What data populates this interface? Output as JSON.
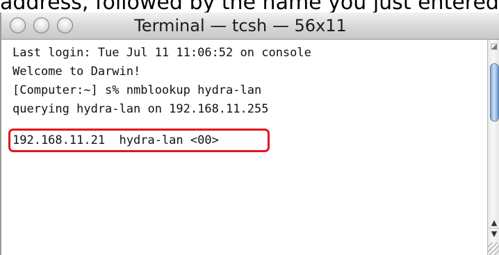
{
  "caption": "address, followed by the name you just entered.",
  "window": {
    "title": "Terminal — tcsh — 56x11"
  },
  "terminal": {
    "lines": [
      "Last login: Tue Jul 11 11:06:52 on console",
      "Welcome to Darwin!",
      "[Computer:~] s% nmblookup hydra-lan",
      "querying hydra-lan on 192.168.11.255",
      "192.168.11.21  hydra-lan <00>"
    ]
  },
  "colors": {
    "highlight": "#e3141b",
    "scroll_thumb": "#7fa6cf"
  },
  "icons": {
    "resize_top": "resize-corner-icon",
    "scroll_up": "arrow-up-icon",
    "scroll_down": "arrow-down-icon"
  }
}
